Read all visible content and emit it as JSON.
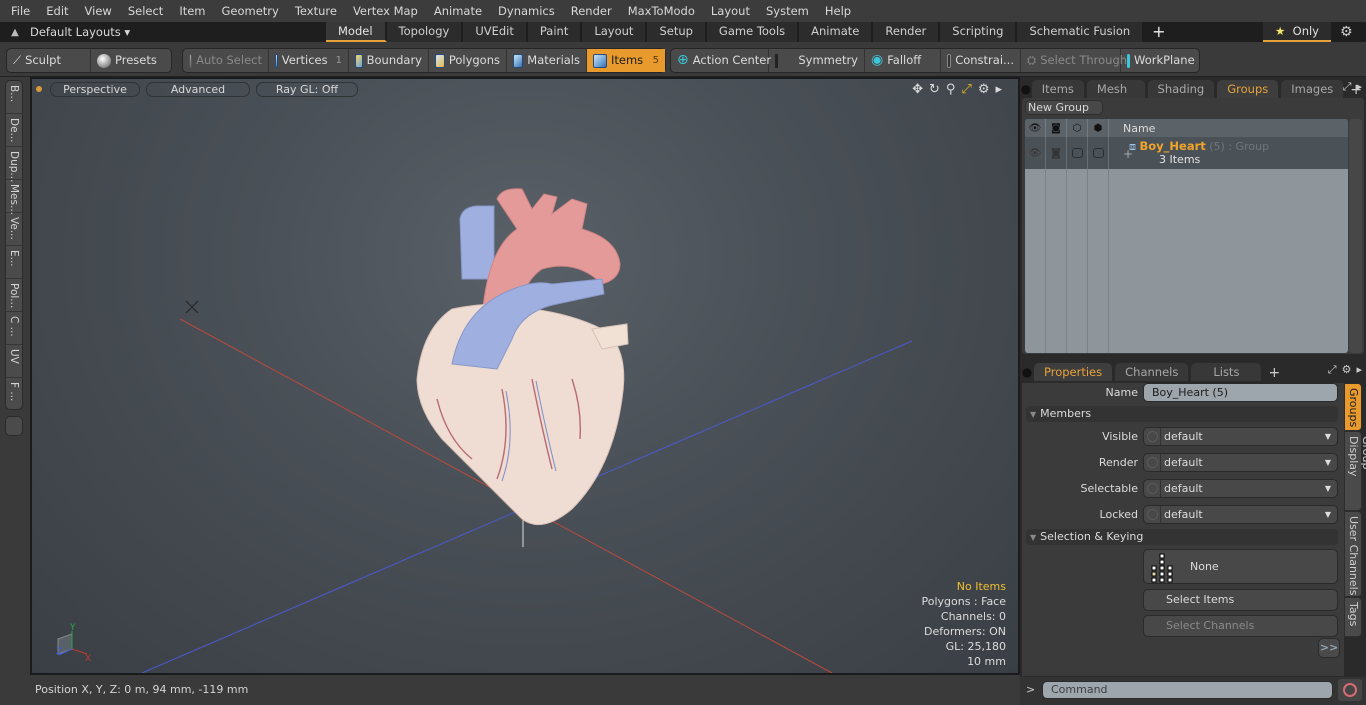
{
  "menu": [
    "File",
    "Edit",
    "View",
    "Select",
    "Item",
    "Geometry",
    "Texture",
    "Vertex Map",
    "Animate",
    "Dynamics",
    "Render",
    "MaxToModo",
    "Layout",
    "System",
    "Help"
  ],
  "layout_bar": {
    "layouts_label": "Default Layouts",
    "tabs": [
      {
        "label": "Model",
        "active": true
      },
      {
        "label": "Topology"
      },
      {
        "label": "UVEdit"
      },
      {
        "label": "Paint"
      },
      {
        "label": "Layout"
      },
      {
        "label": "Setup"
      },
      {
        "label": "Game Tools"
      },
      {
        "label": "Animate"
      },
      {
        "label": "Render"
      },
      {
        "label": "Scripting"
      },
      {
        "label": "Schematic Fusion"
      }
    ],
    "add_tab": "+",
    "only_label": "Only",
    "only_star": "★"
  },
  "toolbar": {
    "sculpt": "Sculpt",
    "presets": "Presets",
    "auto_select": "Auto Select",
    "vertices": "Vertices",
    "vertices_count": "1",
    "boundary": "Boundary",
    "polygons": "Polygons",
    "materials": "Materials",
    "items": "Items",
    "items_count": "5",
    "action_center": "Action Center",
    "symmetry": "Symmetry",
    "falloff": "Falloff",
    "constraints": "Constrai...",
    "select_through": "Select Through",
    "workplane": "WorkPlane"
  },
  "left_tabs": [
    "B...",
    "De...",
    "Dup...",
    "Mes...",
    "Ve...",
    "E...",
    "Pol...",
    "C ...",
    "UV",
    "F ..."
  ],
  "viewport": {
    "view_mode": "Perspective",
    "shading": "Advanced",
    "raygl": "Ray GL: Off",
    "colors": {
      "x_axis": "#c0392b",
      "z_axis": "#3b5bd6"
    },
    "stats": {
      "selection": "No Items",
      "mode": "Polygons : Face",
      "channels": "Channels: 0",
      "deformers": "Deformers: ON",
      "gl": "GL: 25,180",
      "grid": "10 mm"
    },
    "gizmo": {
      "x": "X",
      "y": "Y",
      "z": "Z"
    }
  },
  "status": {
    "position": "Position X, Y, Z:   0 m, 94 mm, -119 mm"
  },
  "scene_panel": {
    "tabs": [
      {
        "label": "Items"
      },
      {
        "label": "Mesh ..."
      },
      {
        "label": "Shading"
      },
      {
        "label": "Groups",
        "active": true
      },
      {
        "label": "Images"
      }
    ],
    "new_group": "New Group",
    "columns": {
      "name": "Name"
    },
    "groups": [
      {
        "name": "Boy_Heart",
        "count": "(5)",
        "type": ": Group",
        "subtitle": "3 Items"
      }
    ]
  },
  "properties_panel": {
    "tabs": [
      {
        "label": "Properties",
        "active": true
      },
      {
        "label": "Channels"
      },
      {
        "label": "Lists"
      }
    ],
    "name_label": "Name",
    "name_value": "Boy_Heart (5)",
    "members_section": "Members",
    "fields": [
      {
        "label": "Visible",
        "value": "default"
      },
      {
        "label": "Render",
        "value": "default"
      },
      {
        "label": "Selectable",
        "value": "default"
      },
      {
        "label": "Locked",
        "value": "default"
      }
    ],
    "selection_section": "Selection & Keying",
    "none_label": "None",
    "select_items": "Select Items",
    "select_channels": "Select Channels",
    "more": ">>",
    "side_tabs": [
      {
        "label": "Groups",
        "active": true
      },
      {
        "label": "Group Display"
      },
      {
        "label": "User Channels"
      },
      {
        "label": "Tags"
      }
    ]
  },
  "command": {
    "prompt": ">",
    "placeholder": "Command"
  }
}
